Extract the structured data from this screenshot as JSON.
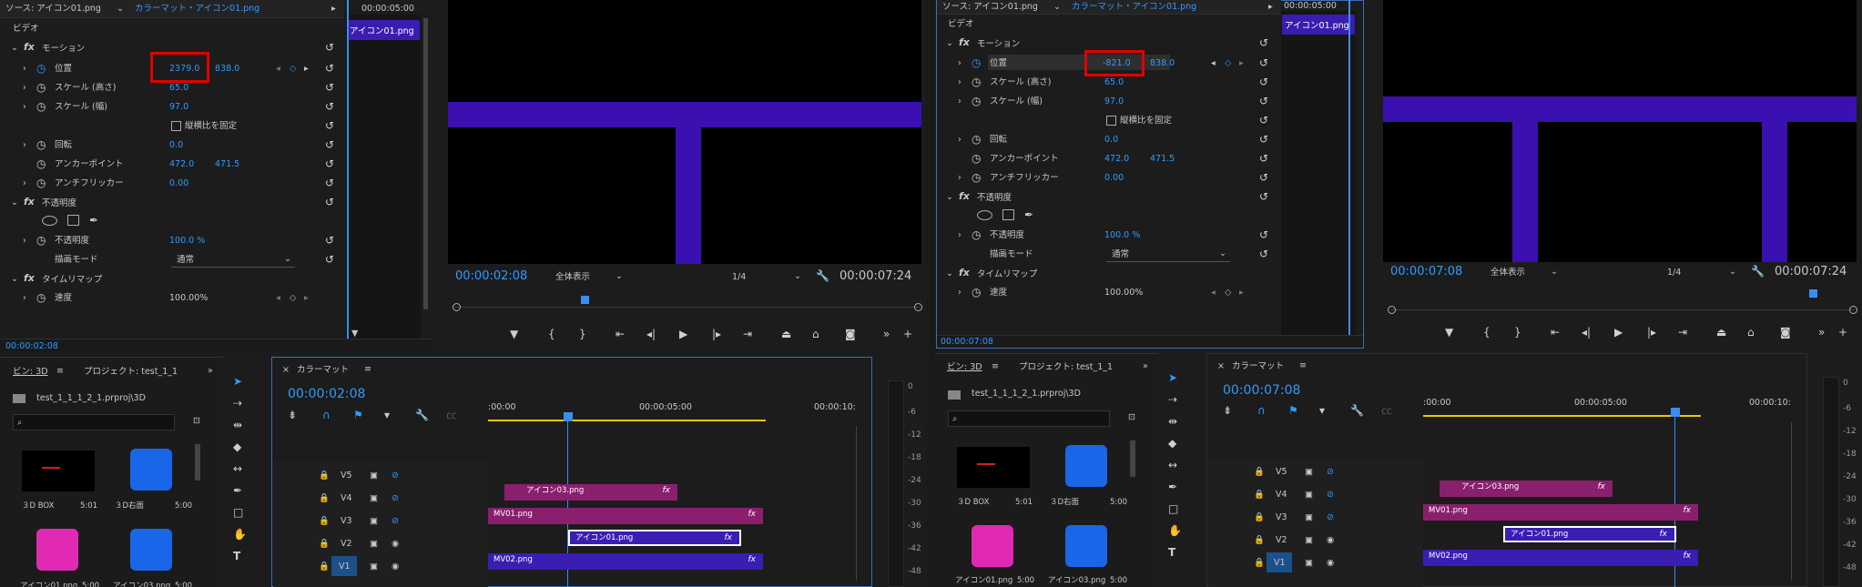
{
  "left": {
    "effect_controls": {
      "tab_source": "ソース: アイコン01.png",
      "tab_clip": "カラーマット・アイコン01.png",
      "timecode_top": "00:00:05:00",
      "mini_clip_label": "アイコン01.png",
      "section_video": "ビデオ",
      "motion": "モーション",
      "position_label": "位置",
      "position_x": "2379.0",
      "position_y": "838.0",
      "scale_h_label": "スケール (高さ)",
      "scale_h": "65.0",
      "scale_w_label": "スケール (幅)",
      "scale_w": "97.0",
      "uniform_scale": "縦横比を固定",
      "rotation_label": "回転",
      "rotation": "0.0",
      "anchor_label": "アンカーポイント",
      "anchor_x": "472.0",
      "anchor_y": "471.5",
      "antiflicker_label": "アンチフリッカー",
      "antiflicker": "0.00",
      "opacity_section": "不透明度",
      "opacity_label": "不透明度",
      "opacity": "100.0 %",
      "blend_label": "描画モード",
      "blend": "通常",
      "timeremap": "タイムリマップ",
      "speed_label": "速度",
      "speed": "100.00%",
      "bottom_timecode": "00:00:02:08"
    },
    "program": {
      "timecode": "00:00:02:08",
      "fit": "全体表示",
      "quality": "1/4",
      "duration": "00:00:07:24"
    },
    "project": {
      "tab_bin": "ビン: 3D",
      "tab_project": "プロジェクト: test_1_1",
      "path": "test_1_1_1_2_1.prproj\\3D",
      "items": [
        {
          "name": "３D BOX",
          "dur": "5:01"
        },
        {
          "name": "３D右面",
          "dur": "5:00"
        },
        {
          "name": "アイコン01.png",
          "dur": "5:00"
        },
        {
          "name": "アイコン03.png",
          "dur": "5:00"
        }
      ]
    },
    "timeline": {
      "title": "カラーマット",
      "timecode": "00:00:02:08",
      "ruler": [
        ":00:00",
        "00:00:05:00",
        "00:00:10:"
      ],
      "tracks": [
        "V5",
        "V4",
        "V3",
        "V2",
        "V1"
      ],
      "clips": {
        "v4": "アイコン03.png",
        "v3": "MV01.png",
        "v2": "アイコン01.png",
        "v1": "MV02.png"
      },
      "fx": "fx"
    },
    "meter": [
      "0",
      "-6",
      "-12",
      "-18",
      "-24",
      "-30",
      "-36",
      "-42",
      "-48"
    ]
  },
  "right": {
    "effect_controls": {
      "tab_source": "ソース: アイコン01.png",
      "tab_clip": "カラーマット・アイコン01.png",
      "timecode_top": "00:00:05:00",
      "mini_clip_label": "アイコン01.png",
      "section_video": "ビデオ",
      "motion": "モーション",
      "position_label": "位置",
      "position_x": "-821.0",
      "position_y": "838.0",
      "scale_h_label": "スケール (高さ)",
      "scale_h": "65.0",
      "scale_w_label": "スケール (幅)",
      "scale_w": "97.0",
      "uniform_scale": "縦横比を固定",
      "rotation_label": "回転",
      "rotation": "0.0",
      "anchor_label": "アンカーポイント",
      "anchor_x": "472.0",
      "anchor_y": "471.5",
      "antiflicker_label": "アンチフリッカー",
      "antiflicker": "0.00",
      "opacity_section": "不透明度",
      "opacity_label": "不透明度",
      "opacity": "100.0 %",
      "blend_label": "描画モード",
      "blend": "通常",
      "timeremap": "タイムリマップ",
      "speed_label": "速度",
      "speed": "100.00%",
      "bottom_timecode": "00:00:07:08"
    },
    "program": {
      "timecode": "00:00:07:08",
      "fit": "全体表示",
      "quality": "1/4",
      "duration": "00:00:07:24"
    },
    "project": {
      "tab_bin": "ビン: 3D",
      "tab_project": "プロジェクト: test_1_1",
      "path": "test_1_1_1_2_1.prproj\\3D",
      "items": [
        {
          "name": "３D BOX",
          "dur": "5:01"
        },
        {
          "name": "３D右面",
          "dur": "5:00"
        },
        {
          "name": "アイコン01.png",
          "dur": "5:00"
        },
        {
          "name": "アイコン03.png",
          "dur": "5:00"
        }
      ]
    },
    "timeline": {
      "title": "カラーマット",
      "timecode": "00:00:07:08",
      "ruler": [
        ":00:00",
        "00:00:05:00",
        "00:00:10:"
      ],
      "tracks": [
        "V5",
        "V4",
        "V3",
        "V2",
        "V1"
      ],
      "clips": {
        "v4": "アイコン03.png",
        "v3": "MV01.png",
        "v2": "アイコン01.png",
        "v1": "MV02.png"
      },
      "fx": "fx"
    },
    "meter": [
      "0",
      "-6",
      "-12",
      "-18",
      "-24",
      "-30",
      "-36",
      "-42",
      "-48"
    ]
  },
  "colors": {
    "accent_blue": "#2f9bff",
    "mask_purple": "#3a10b0",
    "clip_magenta": "#8a1f6e",
    "clip_purple": "#3a1eb4",
    "highlight_red": "#e00000",
    "playhead": "#3b8ef0"
  },
  "icons": [
    "reset-icon",
    "stopwatch-icon",
    "keyframe-diamond-icon",
    "play-icon",
    "wrench-icon",
    "magnet-icon",
    "selection-tool-icon",
    "pen-icon",
    "hand-icon",
    "type-icon",
    "camera-icon"
  ]
}
